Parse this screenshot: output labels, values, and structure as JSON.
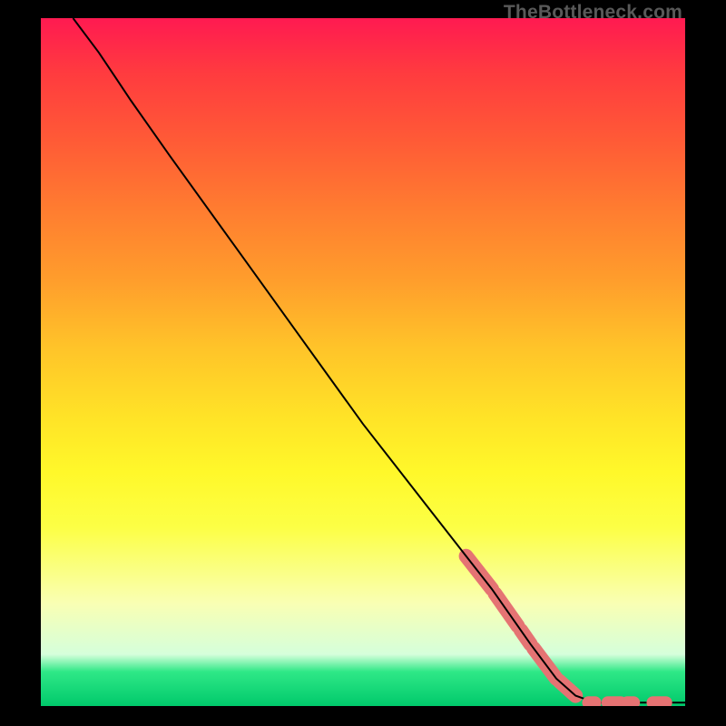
{
  "watermark": "TheBottleneck.com",
  "chart_data": {
    "type": "line",
    "title": "",
    "xlabel": "",
    "ylabel": "",
    "xlim": [
      0,
      100
    ],
    "ylim": [
      0,
      100
    ],
    "series": [
      {
        "name": "curve",
        "points": [
          {
            "x": 5,
            "y": 100
          },
          {
            "x": 9,
            "y": 95
          },
          {
            "x": 14,
            "y": 88
          },
          {
            "x": 20,
            "y": 80
          },
          {
            "x": 30,
            "y": 67
          },
          {
            "x": 40,
            "y": 54
          },
          {
            "x": 50,
            "y": 41
          },
          {
            "x": 60,
            "y": 29
          },
          {
            "x": 70,
            "y": 17
          },
          {
            "x": 76,
            "y": 9
          },
          {
            "x": 80,
            "y": 4
          },
          {
            "x": 83,
            "y": 1.5
          },
          {
            "x": 86,
            "y": 0.5
          },
          {
            "x": 100,
            "y": 0.5
          }
        ]
      }
    ],
    "highlighted_segments": [
      {
        "x0": 66,
        "x1": 70
      },
      {
        "x0": 70.5,
        "x1": 74
      },
      {
        "x0": 74.5,
        "x1": 76
      },
      {
        "x0": 76.5,
        "x1": 80
      },
      {
        "x0": 80.5,
        "x1": 83
      }
    ],
    "flat_segments": [
      {
        "x0": 85,
        "x1": 86
      },
      {
        "x0": 88,
        "x1": 90
      },
      {
        "x0": 91,
        "x1": 92
      },
      {
        "x0": 95,
        "x1": 97
      }
    ],
    "background_gradient": [
      "#ff1a51",
      "#ff5b36",
      "#ff9d2c",
      "#ffe327",
      "#fcff45",
      "#d5ffdb",
      "#00c96b"
    ]
  }
}
